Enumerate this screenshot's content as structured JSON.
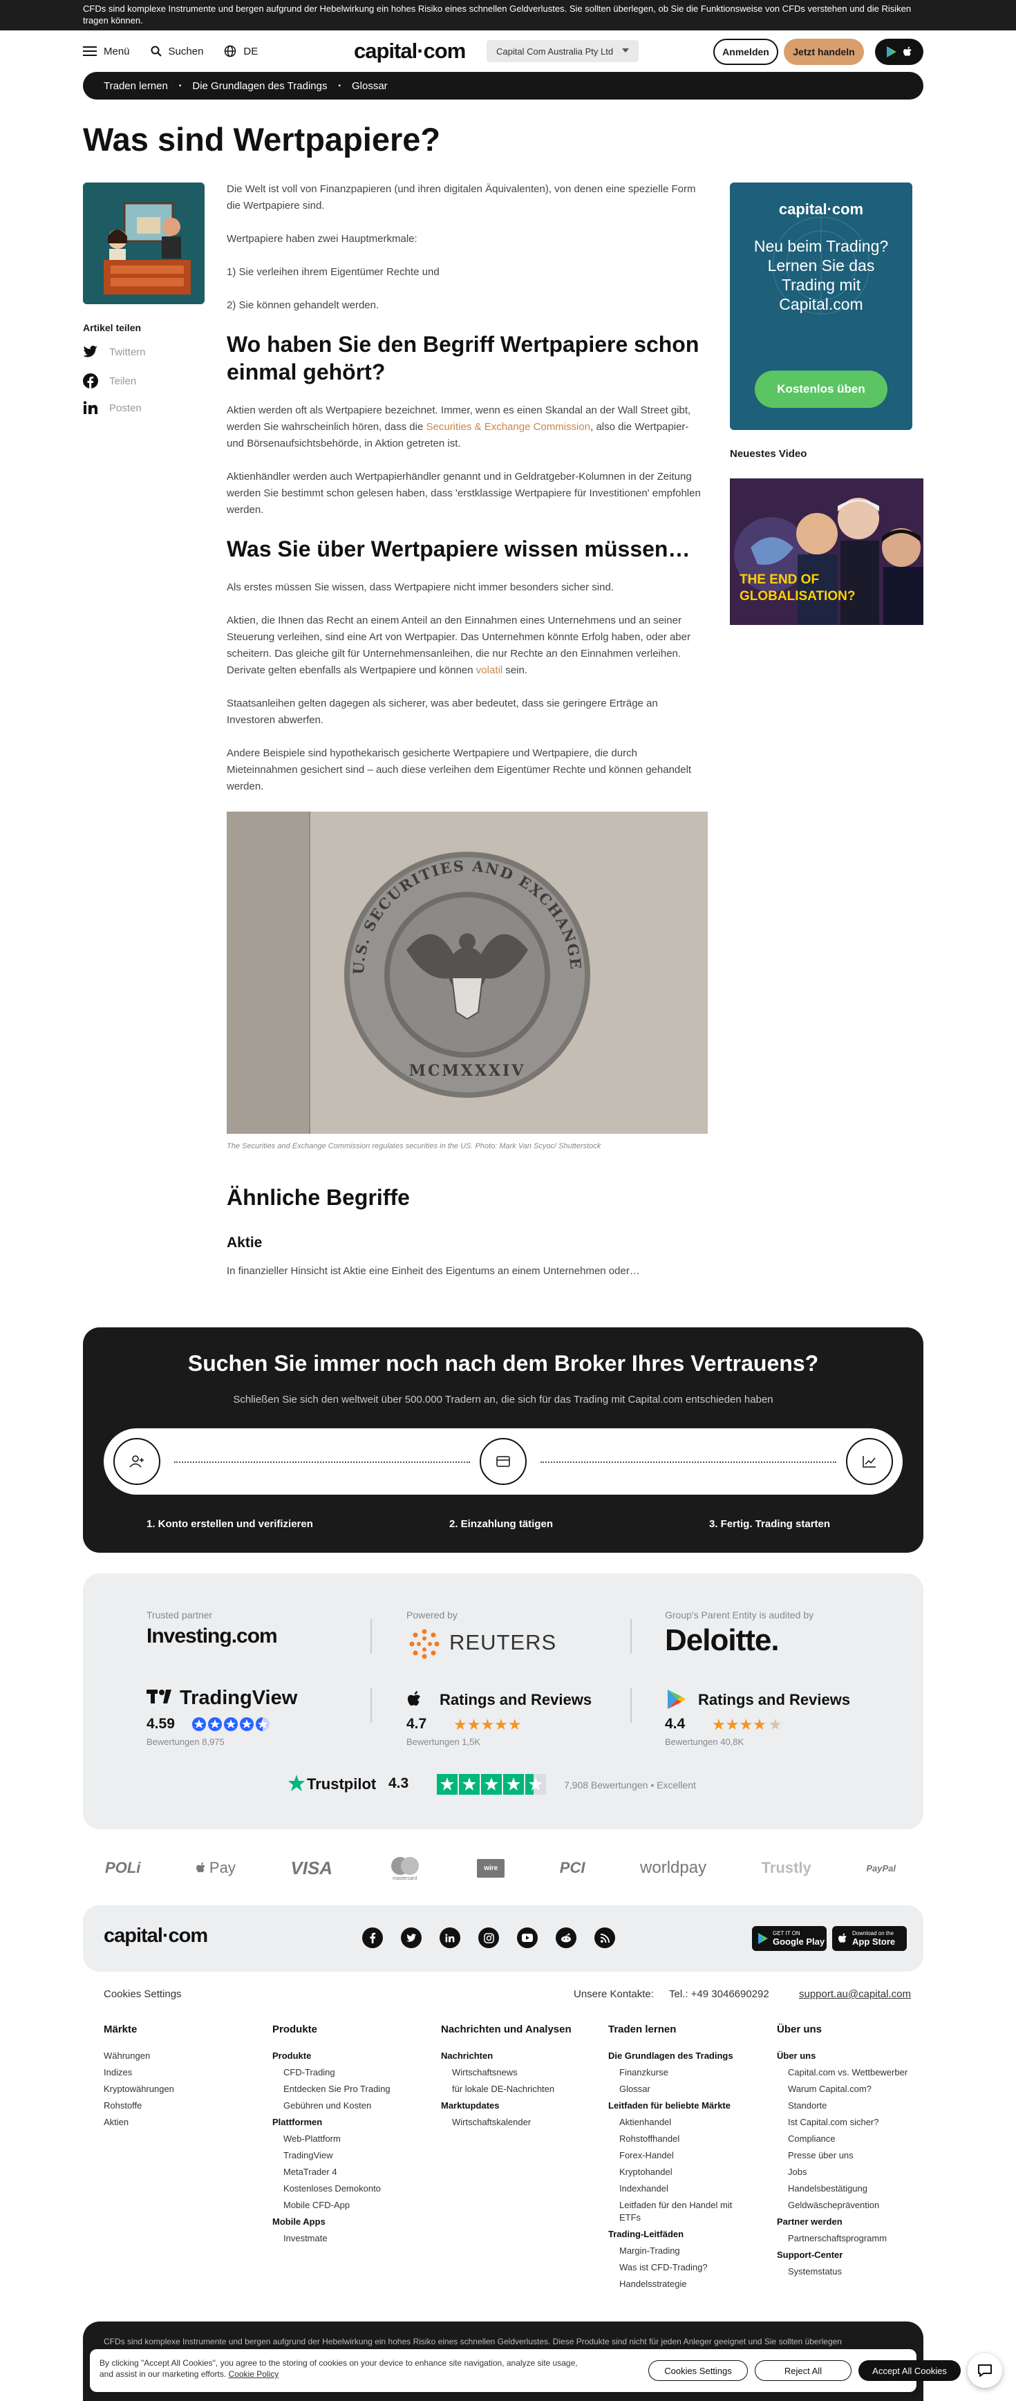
{
  "risk_banner": "CFDs sind komplexe Instrumente und bergen aufgrund der Hebelwirkung ein hohes Risiko eines schnellen Geldverlustes. Sie sollten überlegen, ob Sie die Funktionsweise von CFDs verstehen und die Risiken tragen können.",
  "header": {
    "menu_label": "Menü",
    "search_label": "Suchen",
    "lang_label": "DE",
    "logo": "capital·com",
    "entity": "Capital Com Australia Pty Ltd",
    "login": "Anmelden",
    "trade": "Jetzt handeln"
  },
  "breadcrumb": [
    "Traden lernen",
    "Die Grundlagen des Tradings",
    "Glossar"
  ],
  "page_title": "Was sind Wertpapiere?",
  "share": {
    "title": "Artikel teilen",
    "twitter": "Twittern",
    "facebook": "Teilen",
    "linkedin": "Posten"
  },
  "article": {
    "p1": "Die Welt ist voll von Finanzpapieren (und ihren digitalen Äquivalenten), von denen eine spezielle Form die Wertpapiere sind.",
    "p2": "Wertpapiere haben zwei Hauptmerkmale:",
    "p3": "1) Sie verleihen ihrem Eigentümer Rechte und",
    "p4": "2) Sie können gehandelt werden.",
    "h2a": "Wo haben Sie den Begriff Wertpapiere schon einmal gehört?",
    "p5_pre": "Aktien werden oft als Wertpapiere bezeichnet. Immer, wenn es einen Skandal an der Wall Street gibt, werden Sie wahrscheinlich hören, dass die ",
    "p5_link": "Securities & Exchange Commission",
    "p5_post": ", also die Wertpapier- und Börsenaufsichtsbehörde, in Aktion getreten ist.",
    "p6": "Aktienhändler werden auch Wertpapierhändler genannt und in Geldratgeber-Kolumnen in der Zeitung werden Sie bestimmt schon gelesen haben, dass 'erstklassige Wertpapiere für Investitionen' empfohlen werden.",
    "h2b": "Was Sie über Wertpapiere wissen müssen…",
    "p7": "Als erstes müssen Sie wissen, dass Wertpapiere nicht immer besonders sicher sind.",
    "p8_pre": "Aktien, die Ihnen das Recht an einem Anteil an den Einnahmen eines Unternehmens und an seiner Steuerung verleihen, sind eine Art von Wertpapier. Das Unternehmen könnte Erfolg haben, oder aber scheitern. Das gleiche gilt für Unternehmensanleihen, die nur Rechte an den Einnahmen verleihen. Derivate gelten ebenfalls als Wertpapiere und können ",
    "p8_link": "volatil",
    "p8_post": " sein.",
    "p9": "Staatsanleihen gelten dagegen als sicherer, was aber bedeutet, dass sie geringere Erträge an Investoren abwerfen.",
    "p10": "Andere Beispiele sind hypothekarisch gesicherte Wertpapiere und Wertpapiere, die durch Mieteinnahmen gesichert sind – auch diese verleihen dem Eigentümer Rechte und können gehandelt werden.",
    "seal_text": "U.S. SECURITIES AND EXCHANGE COMMISSION",
    "seal_year": "MCMXXXIV",
    "caption": "The Securities and Exchange Commission regulates securities in the US. Photo: Mark Van Scyoc/ Shutterstock"
  },
  "sidebar": {
    "promo_logo": "capital·com",
    "promo_text": "Neu beim Trading? Lernen Sie das Trading mit Capital.com",
    "promo_button": "Kostenlos üben",
    "video_title": "Neuestes Video",
    "video_caption_line1": "THE END OF",
    "video_caption_line2": "GLOBALISATION?"
  },
  "related": {
    "heading": "Ähnliche Begriffe",
    "item_title": "Aktie",
    "item_text": "In finanzieller Hinsicht ist Aktie eine Einheit des Eigentums an einem Unternehmen oder…"
  },
  "broker": {
    "title": "Suchen Sie immer noch nach dem Broker Ihres Vertrauens?",
    "subtitle": "Schließen Sie sich den weltweit über 500.000 Tradern an, die sich für das Trading mit Capital.com entschieden haben",
    "step1": "1. Konto erstellen und verifizieren",
    "step2": "2. Einzahlung tätigen",
    "step3": "3. Fertig. Trading starten"
  },
  "partners": {
    "label1": "Trusted partner",
    "name1": "Investing.com",
    "label2": "Powered by",
    "name2": "REUTERS",
    "label3": "Group's Parent Entity is audited by",
    "name3": "Deloitte.",
    "tv_name": "TradingView",
    "tv_rating": "4.59",
    "tv_count": "Bewertungen 8,975",
    "apple_name": "Ratings and Reviews",
    "apple_rating": "4.7",
    "apple_count": "Bewertungen 1,5K",
    "google_name": "Ratings and Reviews",
    "google_rating": "4.4",
    "google_count": "Bewertungen 40,8K",
    "tp_name": "Trustpilot",
    "tp_rating": "4.3",
    "tp_count": "7,908 Bewertungen",
    "tp_label": "Excellent"
  },
  "payments": [
    "POLi",
    "Pay",
    "VISA",
    "mastercard",
    "wire",
    "PCI",
    "worldpay",
    "Trustly",
    "PayPal"
  ],
  "footer": {
    "logo": "capital·com",
    "google_play_small": "GET IT ON",
    "google_play": "Google Play",
    "app_store_small": "Download on the",
    "app_store": "App Store",
    "cookie_settings": "Cookies Settings",
    "contacts_label": "Unsere Kontakte:",
    "phone": "Tel.: +49 3046690292",
    "email": "support.au@capital.com",
    "col_maerkte": {
      "heading": "Märkte",
      "items": [
        "Währungen",
        "Indizes",
        "Kryptowährungen",
        "Rohstoffe",
        "Aktien"
      ]
    },
    "col_produkte": {
      "heading": "Produkte",
      "sub1": "Produkte",
      "items1": [
        "CFD-Trading",
        "Entdecken Sie Pro Trading",
        "Gebühren und Kosten"
      ],
      "sub2": "Plattformen",
      "items2": [
        "Web-Plattform",
        "TradingView",
        "MetaTrader 4",
        "Kostenloses Demokonto",
        "Mobile CFD-App"
      ],
      "sub3": "Mobile Apps",
      "items3": [
        "Investmate"
      ]
    },
    "col_news": {
      "heading": "Nachrichten und Analysen",
      "sub1": "Nachrichten",
      "items1": [
        "Wirtschaftsnews",
        "für lokale DE-Nachrichten"
      ],
      "sub2": "Marktupdates",
      "items2": [
        "Wirtschaftskalender"
      ]
    },
    "col_learn": {
      "heading": "Traden lernen",
      "sub1": "Die Grundlagen des Tradings",
      "items1": [
        "Finanzkurse",
        "Glossar"
      ],
      "sub2": "Leitfaden für beliebte Märkte",
      "items2": [
        "Aktienhandel",
        "Rohstoffhandel",
        "Forex-Handel",
        "Kryptohandel",
        "Indexhandel",
        "Leitfaden für den Handel mit ETFs"
      ],
      "sub3": "Trading-Leitfäden",
      "items3": [
        "Margin-Trading",
        "Was ist CFD-Trading?",
        "Handelsstrategie"
      ]
    },
    "col_about": {
      "heading": "Über uns",
      "sub1": "Über uns",
      "items1": [
        "Capital.com vs. Wettbewerber",
        "Warum Capital.com?",
        "Standorte",
        "Ist Capital.com sicher?",
        "Compliance",
        "Presse über uns",
        "Jobs",
        "Handelsbestätigung",
        "Geldwäscheprävention"
      ],
      "sub2": "Partner werden",
      "items2": [
        "Partnerschaftsprogramm"
      ],
      "sub3": "Support-Center",
      "items3": [
        "Systemstatus"
      ]
    }
  },
  "bottom_strip": "CFDs sind komplexe Instrumente und bergen aufgrund der Hebelwirkung ein hohes Risiko eines schnellen Geldverlustes. Diese Produkte sind nicht für jeden Anleger geeignet und Sie sollten überlegen",
  "cookie": {
    "text": "By clicking \"Accept All Cookies\", you agree to the storing of cookies on your device to enhance site navigation, analyze site usage, and assist in our marketing efforts.",
    "policy_link": "Cookie Policy",
    "settings": "Cookies Settings",
    "reject": "Reject All",
    "accept": "Accept All Cookies"
  },
  "colors": {
    "accent_orange": "#d89e6c",
    "promo_blue": "#1e5f79",
    "promo_green": "#5bc563",
    "dark": "#1a1a1a",
    "tp_green": "#00b67a",
    "tv_blue": "#2962ff",
    "star_orange": "#f7931e"
  }
}
